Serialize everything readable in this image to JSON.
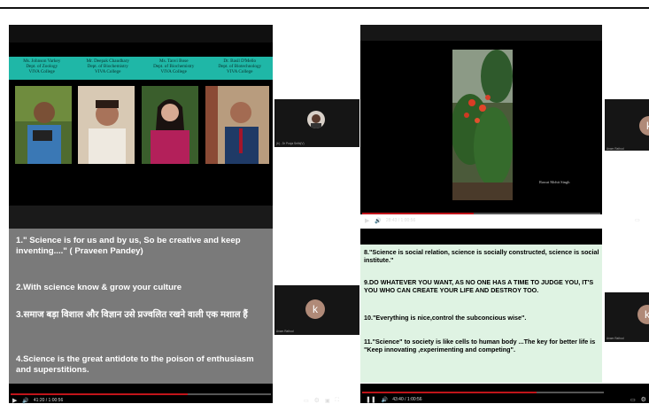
{
  "header": {
    "cells": [
      {
        "name": "Ms. Johnson Varkey",
        "dept": "Dept. of Zoology",
        "college": "VIVA College"
      },
      {
        "name": "Mr. Deepak Chaudhary",
        "dept": "Dept. of Biochemistry",
        "college": "VIVA College"
      },
      {
        "name": "Ms. Tanvi Bose",
        "dept": "Dept. of Biochemistry",
        "college": "VIVA College"
      },
      {
        "name": "Dr. Basil D'Mello",
        "dept": "Dept. of Biotechnology",
        "college": "VIVA College"
      }
    ]
  },
  "participants": {
    "pooja_label": "(b) - Dr Pooja Sethi(V)",
    "anam_label_right_top": "Anam Rathod",
    "anam_label_left": "Anam Rathod",
    "anam_label_right_bottom": "Anam Rathod",
    "avatar_letter": "k"
  },
  "photo_caption": "Rawat Mohit Singh",
  "quotes_left": [
    "1.\" Science is for us and by us, So be creative and keep inventing....\" ( Praveen Pandey)",
    "2.With science know & grow your culture",
    "3.समाज बड़ा विशाल और विज्ञान उसे प्रज्वलित रखने वाली एक मशाल हैं",
    "4.Science is the great antidote to the poison of enthusiasm and superstitions."
  ],
  "quotes_right": [
    "8.\"Science is social relation, science is socially constructed, science is social institute.\"",
    "9.DO WHATEVER YOU WANT, AS NO ONE HAS A TIME TO JUDGE YOU, IT'S YOU WHO CAN CREATE YOUR LIFE AND DESTROY TOO.",
    "10.\"Everything is nice,control the subconcious wise\".",
    "11.\"Science\" to society is like cells to human body ...The key for better life is \"Keep innovating ,experimenting and competing\"."
  ],
  "players": {
    "top_right_time": "28:43 / 1:00:56",
    "bottom_left_time": "41:20 / 1:00:56",
    "bottom_right_time": "43:40 / 1:00:56",
    "top_right_progress": 0.47,
    "bottom_left_progress": 0.68,
    "bottom_right_progress": 0.72
  },
  "colors": {
    "header_teal": "#1fb7a7",
    "progress_red": "#c0141a",
    "quote_grey": "#7a7a7a",
    "quote_mint": "#dff3e3"
  },
  "icons": [
    "play-icon",
    "pause-icon",
    "volume-icon",
    "settings-icon",
    "captions-icon",
    "fullscreen-icon",
    "miniplayer-icon"
  ]
}
